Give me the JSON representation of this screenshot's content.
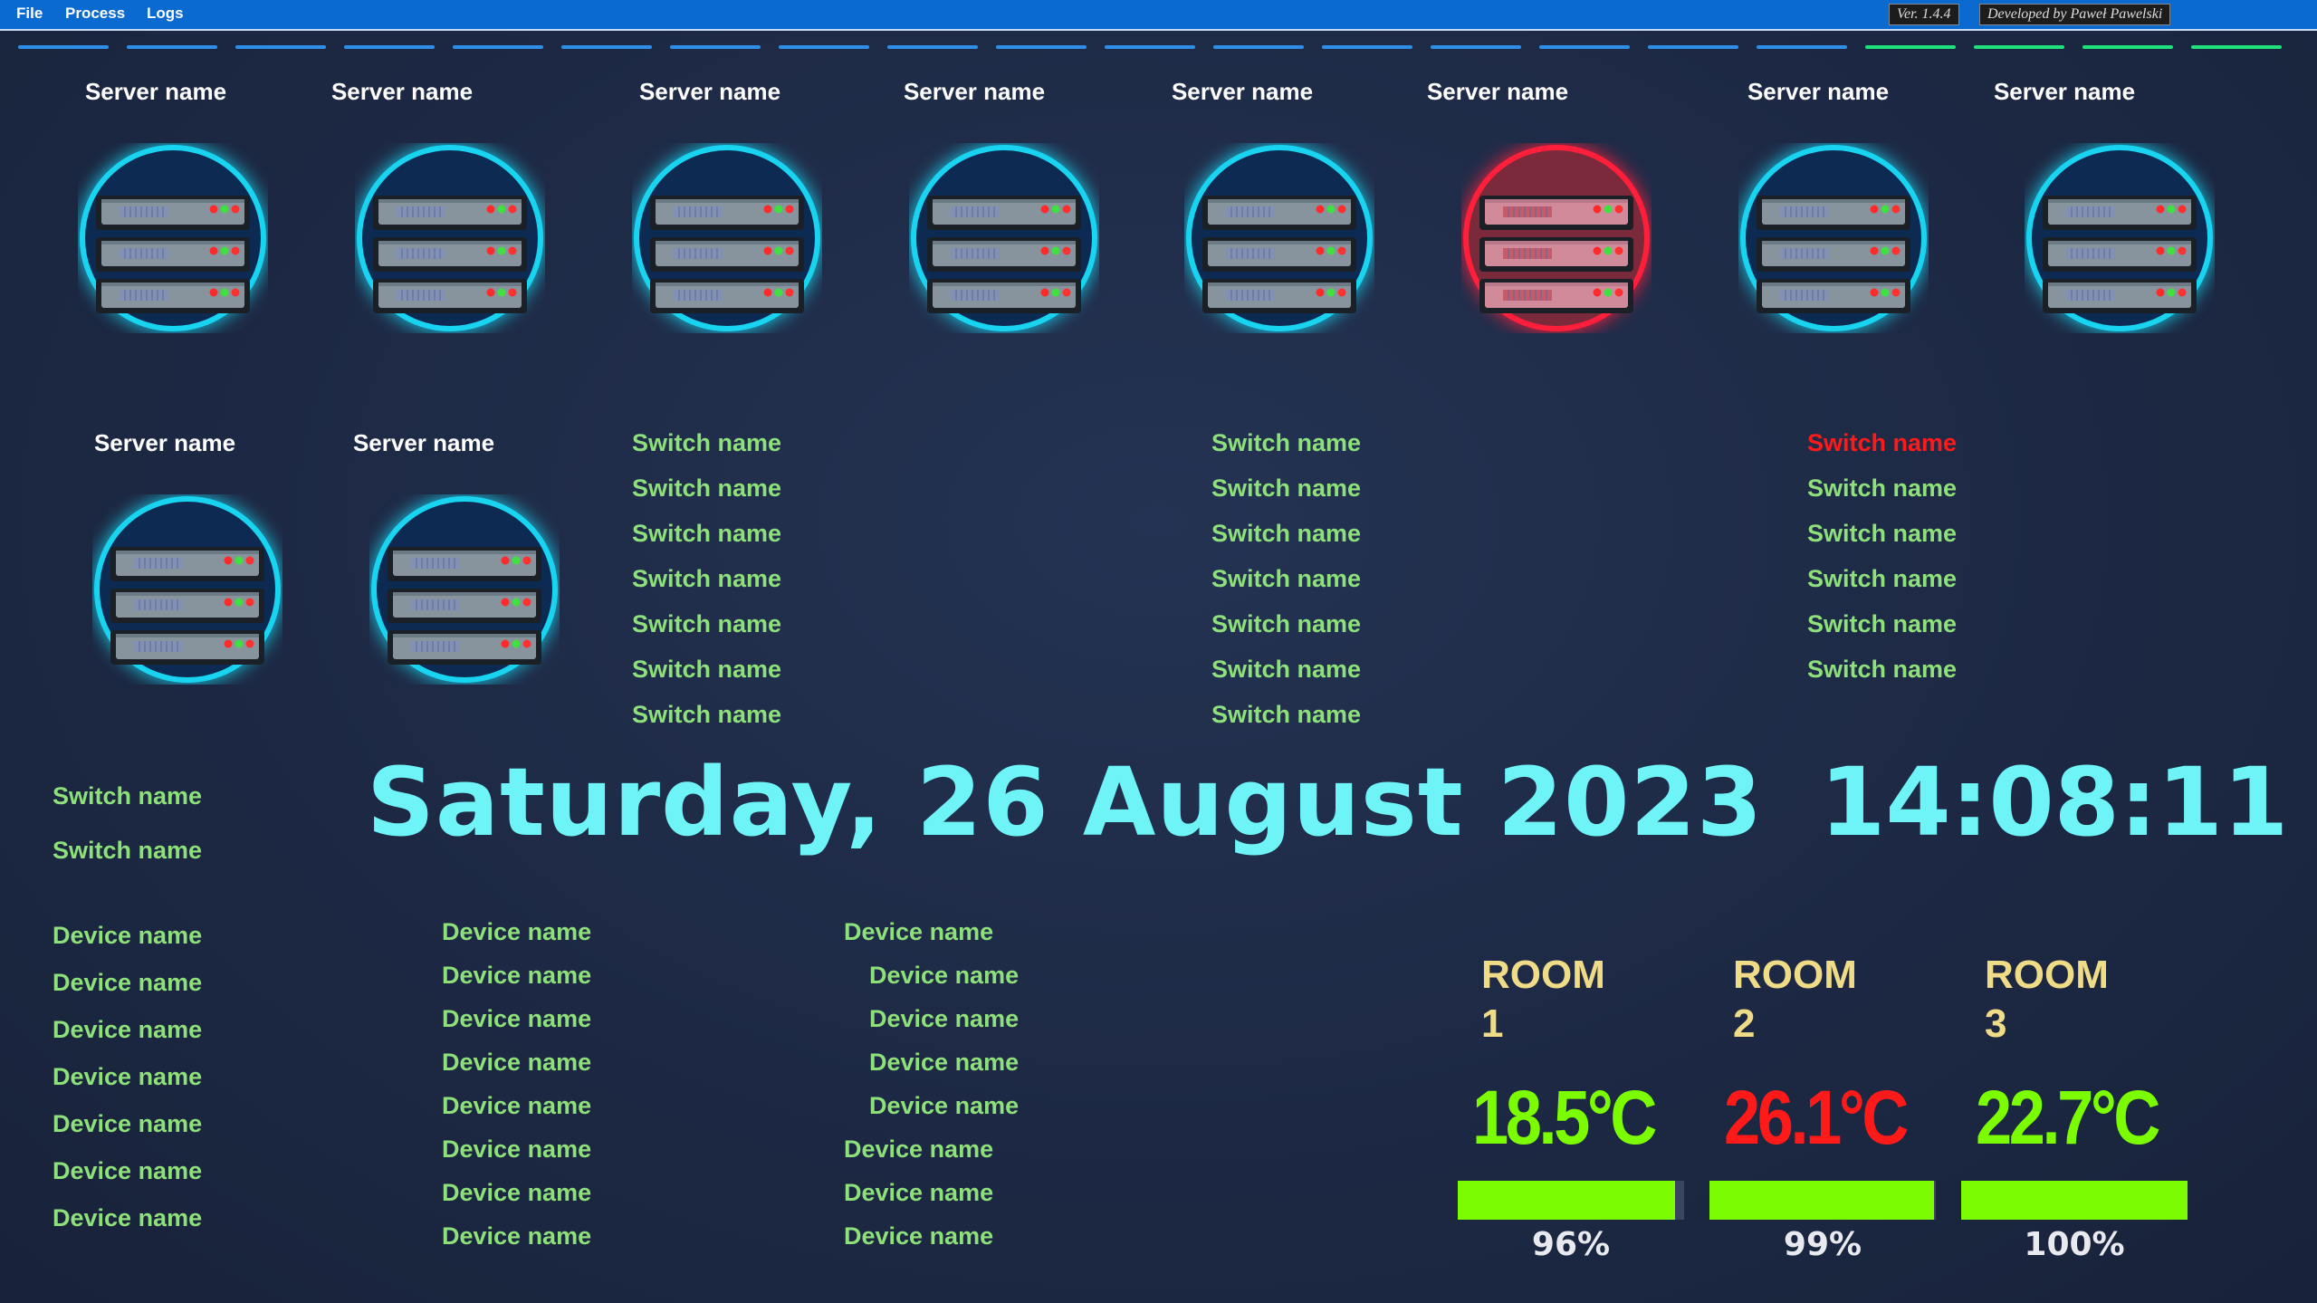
{
  "menu": {
    "items": [
      "File",
      "Process",
      "Logs"
    ]
  },
  "version_badge": "Ver. 1.4.4",
  "developer_badge": "Developed by Paweł Pawelski",
  "status_bar": {
    "segments": [
      "blue",
      "blue",
      "blue",
      "blue",
      "blue",
      "blue",
      "blue",
      "blue",
      "blue",
      "blue",
      "blue",
      "blue",
      "blue",
      "blue",
      "blue",
      "blue",
      "blue",
      "green",
      "green",
      "green",
      "green"
    ],
    "colors": {
      "blue": "#2f8fe8",
      "green": "#1fe07a"
    }
  },
  "servers": [
    {
      "label": "Server name",
      "status": "ok"
    },
    {
      "label": "Server name",
      "status": "ok"
    },
    {
      "label": "Server name",
      "status": "ok"
    },
    {
      "label": "Server name",
      "status": "ok"
    },
    {
      "label": "Server name",
      "status": "ok"
    },
    {
      "label": "Server name",
      "status": "alert"
    },
    {
      "label": "Server name",
      "status": "ok"
    },
    {
      "label": "Server name",
      "status": "ok"
    },
    {
      "label": "Server name",
      "status": "ok"
    },
    {
      "label": "Server name",
      "status": "ok"
    }
  ],
  "switch_columns": [
    {
      "items": [
        {
          "label": "Switch name",
          "status": "ok"
        },
        {
          "label": "Switch name",
          "status": "ok"
        },
        {
          "label": "Switch name",
          "status": "ok"
        },
        {
          "label": "Switch name",
          "status": "ok"
        },
        {
          "label": "Switch name",
          "status": "ok"
        },
        {
          "label": "Switch name",
          "status": "ok"
        },
        {
          "label": "Switch name",
          "status": "ok"
        }
      ]
    },
    {
      "items": [
        {
          "label": "Switch name",
          "status": "ok"
        },
        {
          "label": "Switch name",
          "status": "ok"
        },
        {
          "label": "Switch name",
          "status": "ok"
        },
        {
          "label": "Switch name",
          "status": "ok"
        },
        {
          "label": "Switch name",
          "status": "ok"
        },
        {
          "label": "Switch name",
          "status": "ok"
        },
        {
          "label": "Switch name",
          "status": "ok"
        }
      ]
    },
    {
      "items": [
        {
          "label": "Switch name",
          "status": "alert"
        },
        {
          "label": "Switch name",
          "status": "ok"
        },
        {
          "label": "Switch name",
          "status": "ok"
        },
        {
          "label": "Switch name",
          "status": "ok"
        },
        {
          "label": "Switch name",
          "status": "ok"
        },
        {
          "label": "Switch name",
          "status": "ok"
        }
      ]
    }
  ],
  "left_switches": [
    {
      "label": "Switch name",
      "status": "ok"
    },
    {
      "label": "Switch name",
      "status": "ok"
    }
  ],
  "date_display": "Saturday, 26 August 2023",
  "time_display": "14:08:11",
  "device_columns": [
    {
      "items": [
        "Device name",
        "Device name",
        "Device name",
        "Device name",
        "Device name",
        "Device name",
        "Device name"
      ]
    },
    {
      "items": [
        "Device name",
        "Device name",
        "Device name",
        "Device name",
        "Device name",
        "Device name",
        "Device name",
        "Device name"
      ]
    },
    {
      "items": [
        "Device name",
        "Device name",
        "Device name",
        "Device name",
        "Device name",
        "Device name",
        "Device name",
        "Device name"
      ]
    }
  ],
  "rooms": [
    {
      "name_line1": "ROOM",
      "name_line2": "1",
      "temperature": "18.5°C",
      "status": "ok",
      "humidity_fraction": 0.96,
      "humidity_label": "96%"
    },
    {
      "name_line1": "ROOM",
      "name_line2": "2",
      "temperature": "26.1°C",
      "status": "alert",
      "humidity_fraction": 0.99,
      "humidity_label": "99%"
    },
    {
      "name_line1": "ROOM",
      "name_line2": "3",
      "temperature": "22.7°C",
      "status": "ok",
      "humidity_fraction": 1.0,
      "humidity_label": "100%"
    }
  ],
  "colors": {
    "ok_text": "#8ee07a",
    "alert_text": "#ff1a1a",
    "temp_ok": "#7cfc00",
    "temp_alert": "#ff1a1a",
    "server_glow_ok": "#19d4f0",
    "server_glow_alert": "#ff1f3a",
    "clock": "#6ef4f7",
    "room_label": "#f0dc87"
  },
  "icons": {
    "server": "server-rack-icon"
  }
}
